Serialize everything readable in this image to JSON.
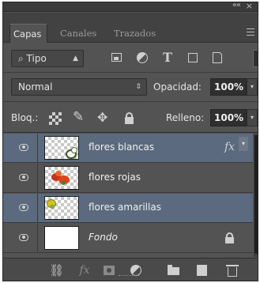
{
  "panel": {
    "collapse_glyph": "««",
    "close_glyph": "×"
  },
  "tabs": [
    {
      "label": "Capas",
      "active": true
    },
    {
      "label": "Canales",
      "active": false
    },
    {
      "label": "Trazados",
      "active": false
    }
  ],
  "filter": {
    "kind_label": "Tipo",
    "icons": [
      "pixel-filter-icon",
      "adjustment-filter-icon",
      "type-filter-icon",
      "shape-filter-icon",
      "smart-object-filter-icon"
    ]
  },
  "blend": {
    "mode": "Normal",
    "opacity_label": "Opacidad:",
    "opacity_value": "100%"
  },
  "lock": {
    "label": "Bloq.:",
    "fill_label": "Relleno:",
    "fill_value": "100%"
  },
  "layers": [
    {
      "name": "flores blancas",
      "selected": true,
      "visible": true,
      "has_fx": true,
      "fx_label": "fx",
      "thumb": "transparent-white-flowers"
    },
    {
      "name": "flores rojas",
      "selected": false,
      "visible": true,
      "thumb": "red-flowers"
    },
    {
      "name": "flores amarillas",
      "selected": true,
      "visible": true,
      "thumb": "transparent-yellow-flowers"
    },
    {
      "name": "Fondo",
      "selected": false,
      "visible": true,
      "locked": true,
      "thumb": "white"
    }
  ],
  "bottom_toolbar": {
    "fx_label": "fx",
    "icons": [
      "link-icon",
      "fx-icon",
      "layer-mask-icon",
      "adjustment-layer-icon",
      "group-folder-icon",
      "new-layer-icon",
      "trash-icon"
    ]
  },
  "colors": {
    "panel_bg": "#535353",
    "selected_row": "#5b6a7e"
  }
}
